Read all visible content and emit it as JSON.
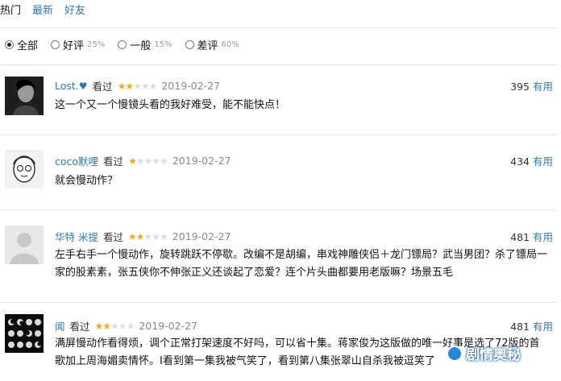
{
  "tabs": [
    "热门",
    "最新",
    "好友"
  ],
  "filters": [
    {
      "label": "全部",
      "pct": "",
      "selected": true
    },
    {
      "label": "好评",
      "pct": "25%",
      "selected": false
    },
    {
      "label": "一般",
      "pct": "15%",
      "selected": false
    },
    {
      "label": "差评",
      "pct": "60%",
      "selected": false
    }
  ],
  "comments": [
    {
      "user": "Lost.",
      "status": "看过",
      "rating": 2,
      "date": "2019-02-27",
      "votes": "395",
      "useful": "有用",
      "text": "这一个又一个慢镜头看的我好难受，能不能快点！"
    },
    {
      "user": "coco默哩",
      "status": "看过",
      "rating": 1,
      "date": "2019-02-27",
      "votes": "434",
      "useful": "有用",
      "text": "就会慢动作？"
    },
    {
      "user": "华特 米提",
      "status": "看过",
      "rating": 2,
      "date": "2019-02-27",
      "votes": "481",
      "useful": "有用",
      "text": "左手右手一个慢动作，旋转跳跃不停歇。改编不是胡编，串戏神雕侠侣＋龙门镖局？武当男团？杀了镖局一家的股素素，张五侠你不伸张正义还谈起了恋爱？连个片头曲都要用老版嘛？场景五毛"
    },
    {
      "user": "闻",
      "status": "看过",
      "rating": 2,
      "date": "2019-02-27",
      "votes": "481",
      "useful": "有用",
      "text": "满屏慢动作看得烦，调个正常打架速度不好吗，可以省十集。蒋家俊为这版做的唯一好事是选了72版的首歌加上周海媚卖情怀。I看到第一集我被气笑了，看到第八集张翠山自杀我被逗笑了"
    }
  ],
  "watermark": "剧情奥秘"
}
